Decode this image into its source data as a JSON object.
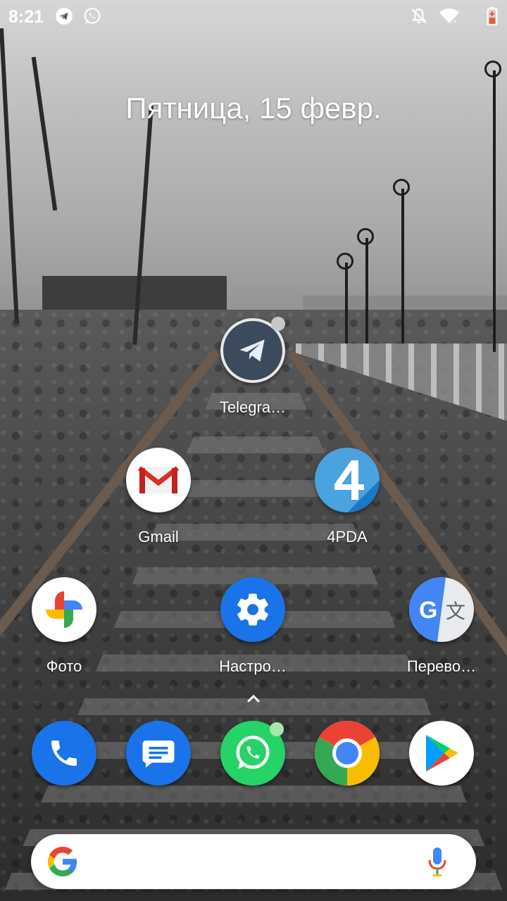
{
  "status_bar": {
    "time": "8:21",
    "left_icons": [
      "telegram-icon",
      "whatsapp-icon"
    ],
    "right_icons": [
      "do-not-disturb-icon",
      "wifi-icon",
      "battery-charging-icon"
    ]
  },
  "date": "Пятница, 15 февр.",
  "apps": [
    {
      "name": "telegram",
      "label": "Telegra…",
      "icon": "telegram-x-icon",
      "badge": true
    },
    {
      "name": "gmail",
      "label": "Gmail",
      "icon": "gmail-icon",
      "badge": false
    },
    {
      "name": "4pda",
      "label": "4PDA",
      "icon": "4pda-icon",
      "badge": false
    },
    {
      "name": "photos",
      "label": "Фото",
      "icon": "google-photos-icon",
      "badge": false
    },
    {
      "name": "settings",
      "label": "Настро…",
      "icon": "settings-gear-icon",
      "badge": false
    },
    {
      "name": "translate",
      "label": "Перево…",
      "icon": "google-translate-icon",
      "badge": false
    }
  ],
  "dock": [
    {
      "name": "phone",
      "icon": "phone-icon"
    },
    {
      "name": "messages",
      "icon": "messages-icon"
    },
    {
      "name": "whatsapp",
      "icon": "whatsapp-icon",
      "badge": true
    },
    {
      "name": "chrome",
      "icon": "chrome-icon"
    },
    {
      "name": "play-store",
      "icon": "play-store-icon"
    }
  ],
  "app_drawer_hint": "chevron-up-icon",
  "search_bar": {
    "left_icon": "google-g-icon",
    "right_icon": "microphone-icon"
  },
  "colors": {
    "telegram_bg": "#3b4a5d",
    "gmail_bg": "#ffffff",
    "pda_bg": "#4aa3df",
    "settings_bg": "#1a73e8",
    "translate_blue": "#4285f4",
    "phone_bg": "#1a73e8",
    "messages_bg": "#1a73e8",
    "whatsapp_bg": "#25d366",
    "badge_color": "#c7c7c7",
    "whatsapp_badge": "#a8e6b0"
  }
}
